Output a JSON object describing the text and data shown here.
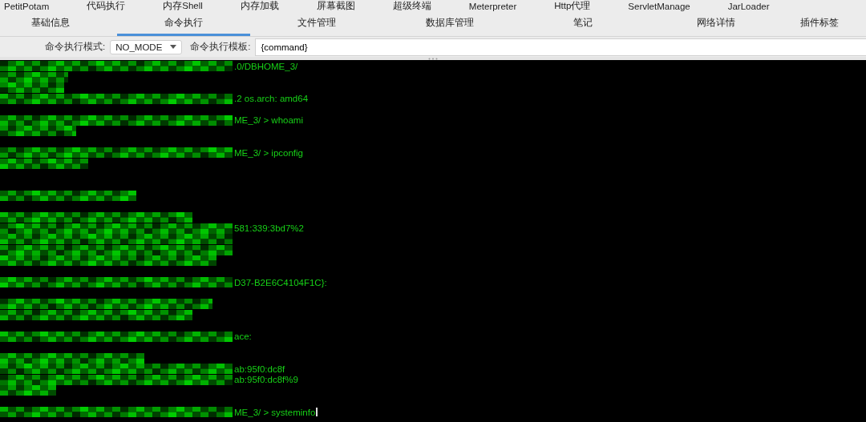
{
  "plugin_tabs": [
    {
      "label": "PetitPotam",
      "selected": false
    },
    {
      "label": "代码执行",
      "selected": false
    },
    {
      "label": "内存Shell",
      "selected": false
    },
    {
      "label": "内存加载",
      "selected": false
    },
    {
      "label": "屏幕截图",
      "selected": false
    },
    {
      "label": "超级终端",
      "selected": false
    },
    {
      "label": "Meterpreter",
      "selected": false
    },
    {
      "label": "Http代理",
      "selected": false
    },
    {
      "label": "ServletManage",
      "selected": false
    },
    {
      "label": "JarLoader",
      "selected": false
    }
  ],
  "tabs": [
    {
      "label": "基础信息",
      "selected": false
    },
    {
      "label": "命令执行",
      "selected": true
    },
    {
      "label": "文件管理",
      "selected": false
    },
    {
      "label": "数据库管理",
      "selected": false
    },
    {
      "label": "笔记",
      "selected": false
    },
    {
      "label": "网络详情",
      "selected": false
    },
    {
      "label": "插件标签",
      "selected": false
    }
  ],
  "toolbar": {
    "mode_label": "命令执行模式:",
    "mode_value": "NO_MODE",
    "template_label": "命令执行模板:",
    "template_value": "{command}"
  },
  "terminal": {
    "lines": [
      {
        "kind": "text",
        "text": ".0/DBHOME_3/"
      },
      {
        "kind": "redacted"
      },
      {
        "kind": "redacted"
      },
      {
        "kind": "text",
        "text": ".2 os.arch: amd64"
      },
      {
        "kind": "blank"
      },
      {
        "kind": "text",
        "text": "ME_3/ > whoami"
      },
      {
        "kind": "redacted"
      },
      {
        "kind": "blank"
      },
      {
        "kind": "text",
        "text": "ME_3/ > ipconfig"
      },
      {
        "kind": "redacted"
      },
      {
        "kind": "blank"
      },
      {
        "kind": "blank"
      },
      {
        "kind": "redacted"
      },
      {
        "kind": "blank"
      },
      {
        "kind": "redacted"
      },
      {
        "kind": "text",
        "text": "581:339:3bd7%2"
      },
      {
        "kind": "redacted"
      },
      {
        "kind": "redacted"
      },
      {
        "kind": "redacted"
      },
      {
        "kind": "blank"
      },
      {
        "kind": "text",
        "text": "D37-B2E6C4104F1C}:"
      },
      {
        "kind": "blank"
      },
      {
        "kind": "redacted"
      },
      {
        "kind": "redacted"
      },
      {
        "kind": "blank"
      },
      {
        "kind": "text",
        "text": "ace:"
      },
      {
        "kind": "blank"
      },
      {
        "kind": "redacted"
      },
      {
        "kind": "text",
        "text": "ab:95f0:dc8f"
      },
      {
        "kind": "text",
        "text": "ab:95f0:dc8f%9"
      },
      {
        "kind": "redacted"
      },
      {
        "kind": "blank"
      },
      {
        "kind": "prompt",
        "text": "ME_3/ > systeminfo"
      }
    ]
  }
}
